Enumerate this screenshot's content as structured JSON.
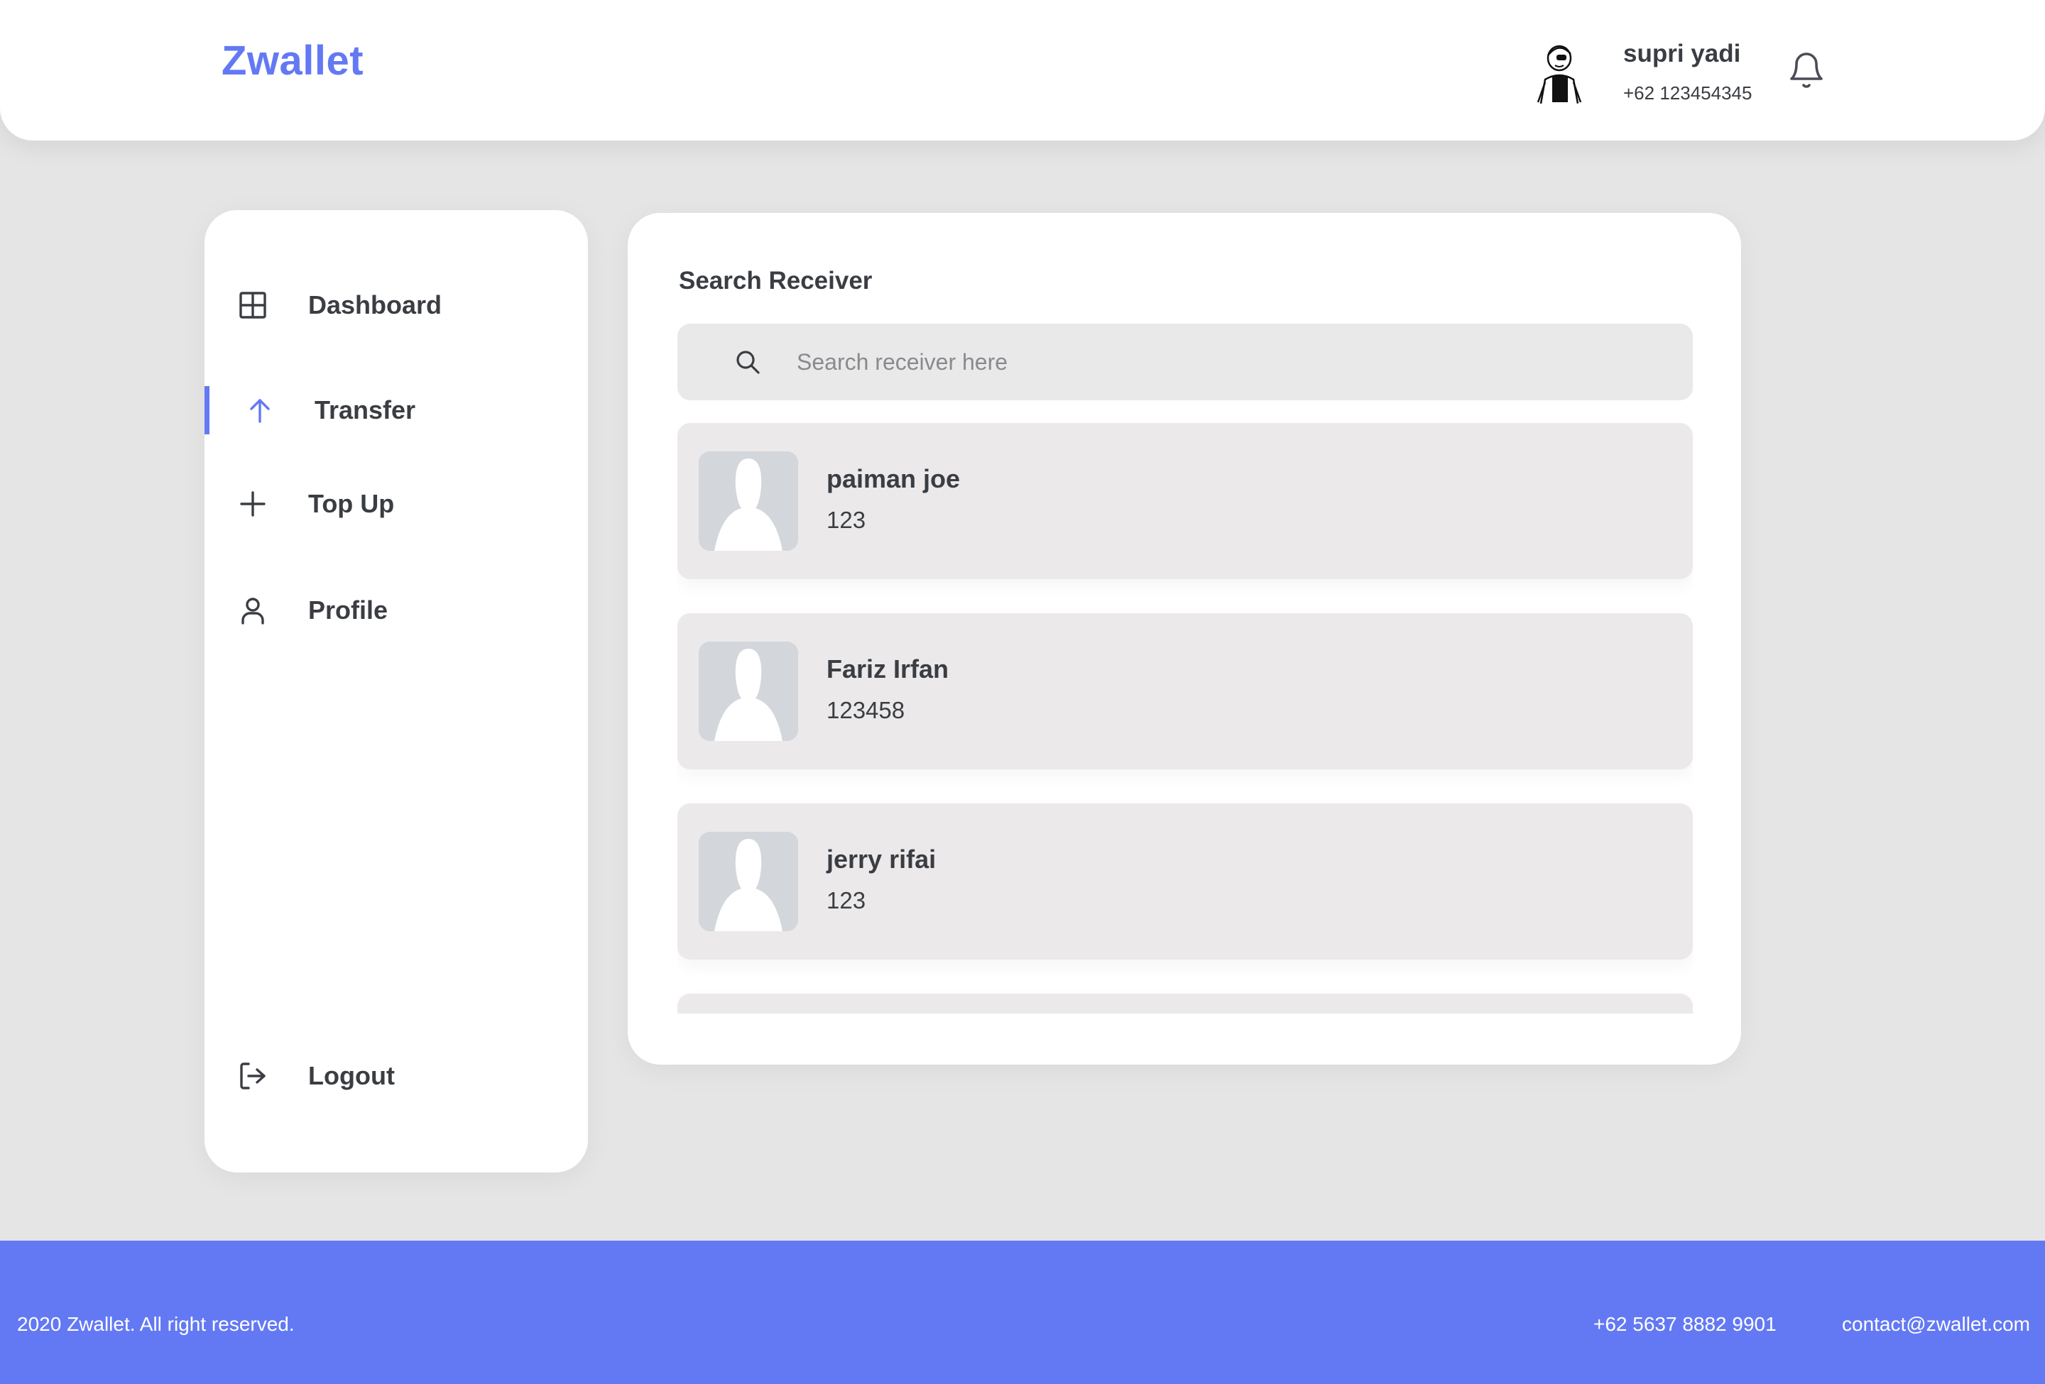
{
  "header": {
    "brand": "Zwallet",
    "user": {
      "name": "supri yadi",
      "phone": "+62 123454345",
      "avatar_icon": "user-avatar-illustration"
    },
    "notification_icon": "bell-icon"
  },
  "sidebar": {
    "items": [
      {
        "label": "Dashboard",
        "icon": "grid-icon",
        "active": false
      },
      {
        "label": "Transfer",
        "icon": "arrow-up-icon",
        "active": true
      },
      {
        "label": "Top Up",
        "icon": "plus-icon",
        "active": false
      },
      {
        "label": "Profile",
        "icon": "user-icon",
        "active": false
      }
    ],
    "logout": {
      "label": "Logout",
      "icon": "logout-icon"
    }
  },
  "main": {
    "title": "Search Receiver",
    "search": {
      "placeholder": "Search receiver here",
      "value": ""
    },
    "receivers": [
      {
        "name": "paiman joe",
        "phone": "123"
      },
      {
        "name": "Fariz Irfan",
        "phone": "123458"
      },
      {
        "name": "jerry rifai",
        "phone": "123"
      }
    ]
  },
  "footer": {
    "copyright": "2020 Zwallet. All right reserved.",
    "phone": "+62 5637 8882 9901",
    "email": "contact@zwallet.com"
  },
  "colors": {
    "accent": "#6379f4",
    "background": "#e5e5e5",
    "card": "#ffffff",
    "text": "#3a3d42",
    "list_item": "#ebe9ea"
  }
}
